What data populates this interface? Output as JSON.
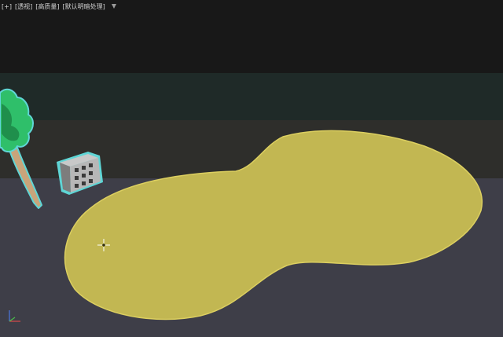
{
  "viewport": {
    "labels": {
      "plus": "[+]",
      "view": "[透视]",
      "shading": "[高质量]",
      "lighting": "[默认明暗处理]"
    },
    "filter_icon": "funnel-icon"
  },
  "scene": {
    "objects": [
      "palm-tree",
      "building",
      "sand-island"
    ],
    "colors": {
      "sand": "#c2b752",
      "sand_outline": "#dccf60",
      "selection": "#5fd6d6",
      "foliage": "#2fbf6a",
      "trunk": "#c9a47a",
      "ground": "#3e3e48",
      "sky": "#181818"
    }
  },
  "cursor_icon": "crosshair-cursor-icon",
  "gizmo_icon": "axis-gizmo-icon"
}
